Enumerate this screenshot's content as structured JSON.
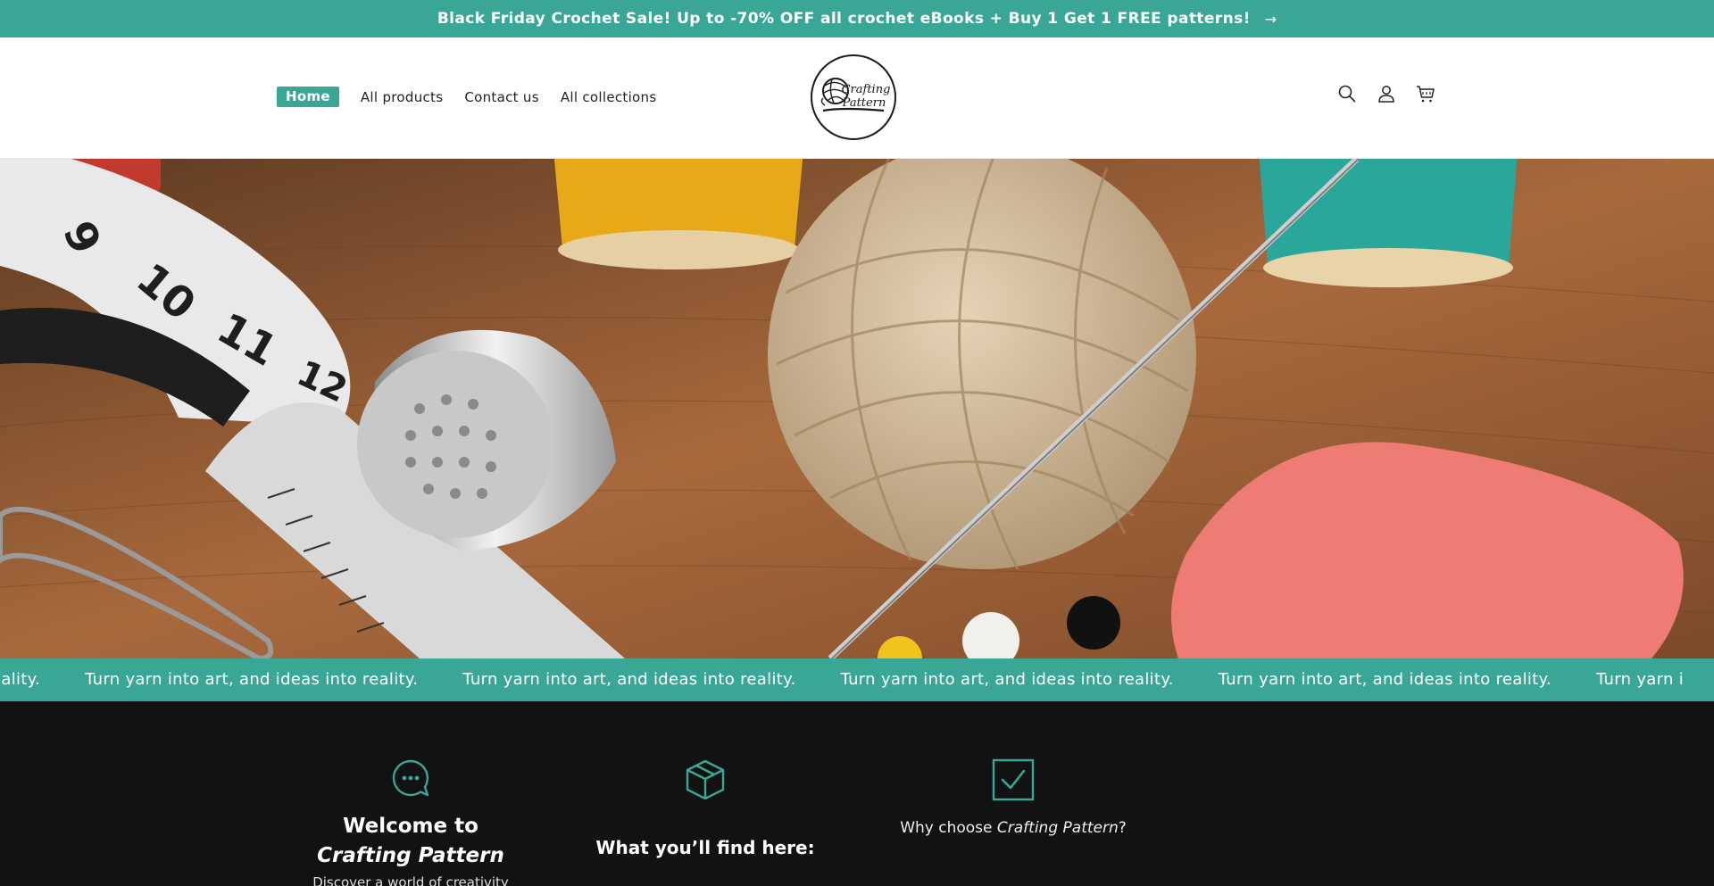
{
  "announcement": {
    "text": "Black Friday Crochet Sale! Up to -70% OFF all crochet eBooks + Buy 1 Get 1 FREE patterns!",
    "arrow": "→"
  },
  "header": {
    "nav": [
      {
        "label": "Home",
        "active": true
      },
      {
        "label": "All products",
        "active": false
      },
      {
        "label": "Contact us",
        "active": false
      },
      {
        "label": "All collections",
        "active": false
      }
    ],
    "logo": {
      "line1": "Crafting",
      "line2": "Pattern"
    },
    "icons": [
      "search-icon",
      "account-icon",
      "cart-icon"
    ]
  },
  "hero": {
    "image": "sewing and crochet supplies"
  },
  "marquee": {
    "text": "Turn yarn into art, and ideas into reality.",
    "partial_start": "to reality.",
    "partial_end": "Turn yarn i"
  },
  "features": {
    "f1": {
      "icon": "chat-bubble-icon",
      "title_line1": "Welcome to",
      "title_line2": "Crafting Pattern",
      "body": "Discover a world of creativity"
    },
    "f2": {
      "icon": "box-icon",
      "title": "What you’ll find here:"
    },
    "f3": {
      "icon": "checkbox-icon",
      "title_prefix": "Why choose ",
      "title_em": "Crafting Pattern",
      "title_suffix": "?"
    }
  },
  "colors": {
    "accent": "#3aa796",
    "dark": "#121212"
  }
}
